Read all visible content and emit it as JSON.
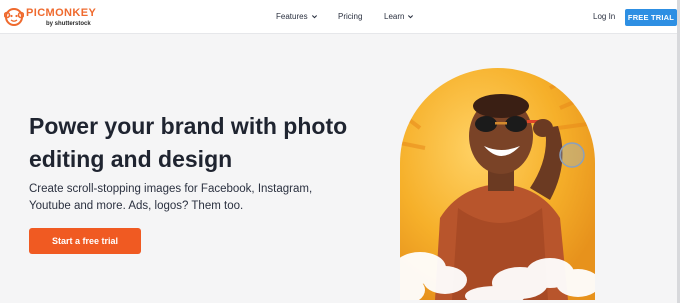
{
  "brand": {
    "name": "PICMONKEY",
    "sub": "by shutterstock",
    "color": "#ef6a2e"
  },
  "nav": {
    "items": [
      {
        "label": "Features",
        "has_dropdown": true
      },
      {
        "label": "Pricing",
        "has_dropdown": false
      },
      {
        "label": "Learn",
        "has_dropdown": true
      }
    ],
    "login_label": "Log In",
    "trial_label": "FREE TRIAL",
    "trial_color": "#2d8fe3"
  },
  "hero": {
    "headline": "Power your brand with photo editing and design",
    "subtext": "Create scroll-stopping images for Facebook, Instagram, Youtube and more. Ads, logos? Them too.",
    "cta_label": "Start a free trial",
    "cta_color": "#f05a22",
    "image_background": "#f5b42a"
  }
}
